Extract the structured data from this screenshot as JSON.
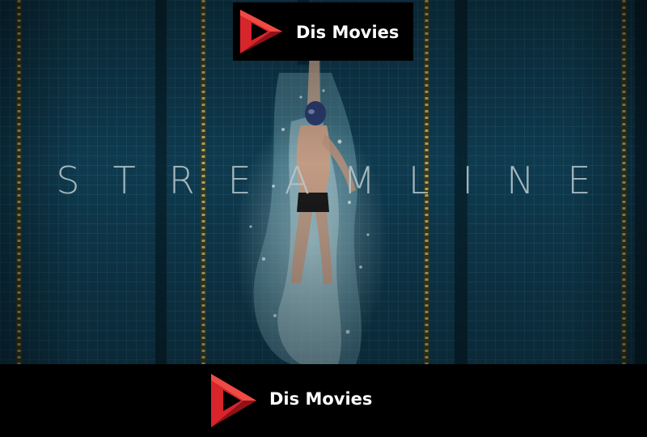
{
  "poster": {
    "title": "STREAMLINE"
  },
  "brand": {
    "name": "Dis Movies",
    "logo_icon": "play-triangle-icon",
    "accent": "#d8242b",
    "accent_dark": "#8e1217"
  },
  "colors": {
    "pool_water": "#0d3447",
    "tile_grid": "#1e5a73",
    "lane_rope": "#c9b257",
    "background": "#000000"
  }
}
